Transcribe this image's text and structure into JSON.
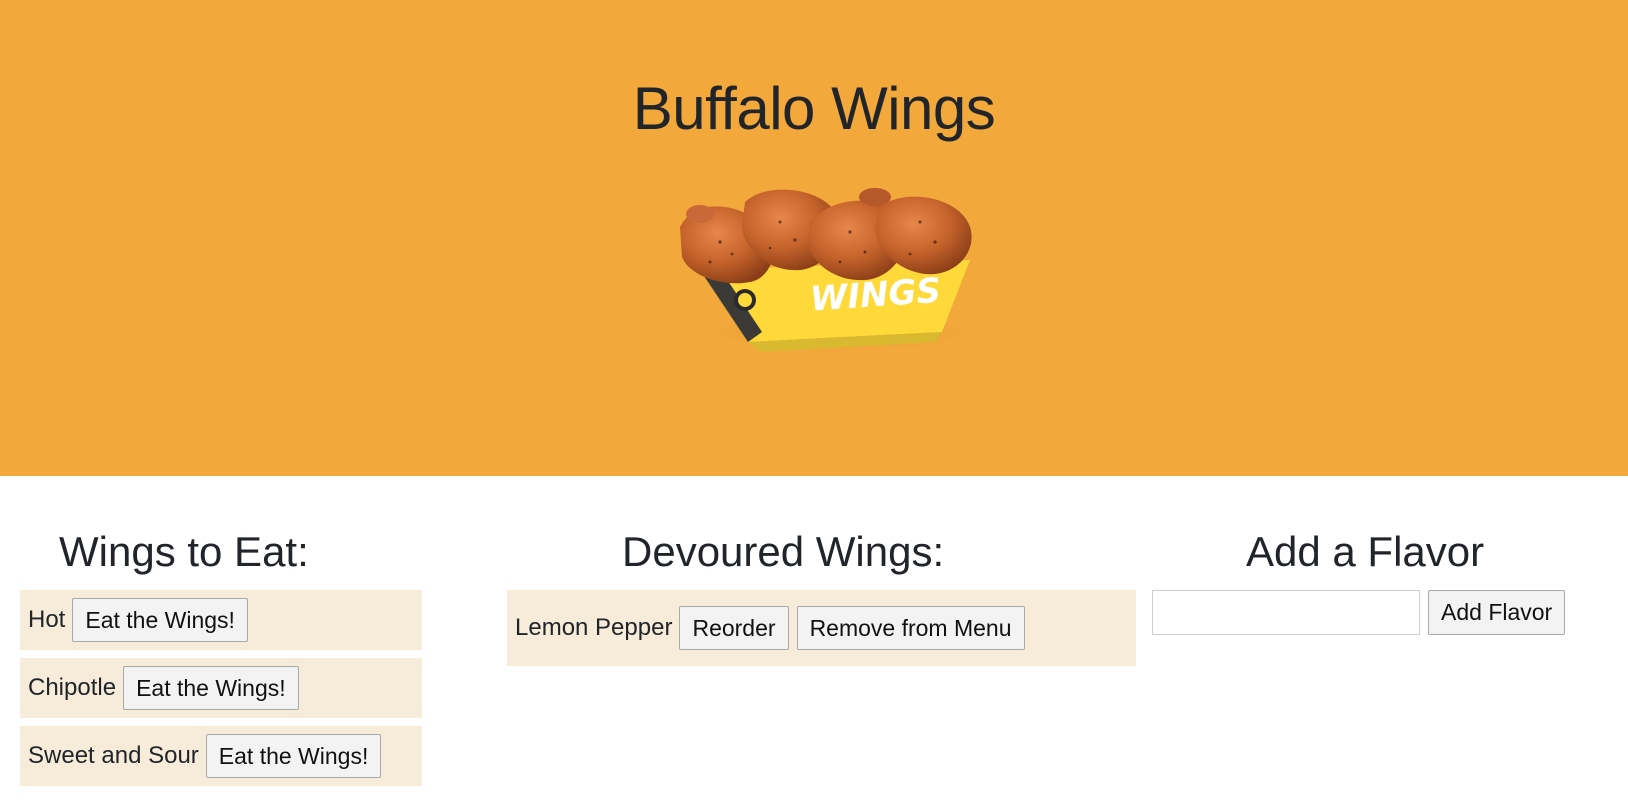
{
  "hero": {
    "title": "Buffalo Wings",
    "image_alt": "wings-basket"
  },
  "wings_to_eat": {
    "heading": "Wings to Eat:",
    "items": [
      {
        "name": "Hot",
        "button": "Eat the Wings!"
      },
      {
        "name": "Chipotle",
        "button": "Eat the Wings!"
      },
      {
        "name": "Sweet and Sour",
        "button": "Eat the Wings!"
      }
    ]
  },
  "devoured": {
    "heading": "Devoured Wings:",
    "items": [
      {
        "name": "Lemon Pepper",
        "reorder_button": "Reorder",
        "remove_button": "Remove from Menu"
      }
    ]
  },
  "add_flavor": {
    "heading": "Add a Flavor",
    "input_value": "",
    "input_placeholder": "",
    "button": "Add Flavor"
  },
  "colors": {
    "hero_bg": "#f2a83a",
    "item_bg": "#f7ebd9",
    "text": "#212529"
  }
}
